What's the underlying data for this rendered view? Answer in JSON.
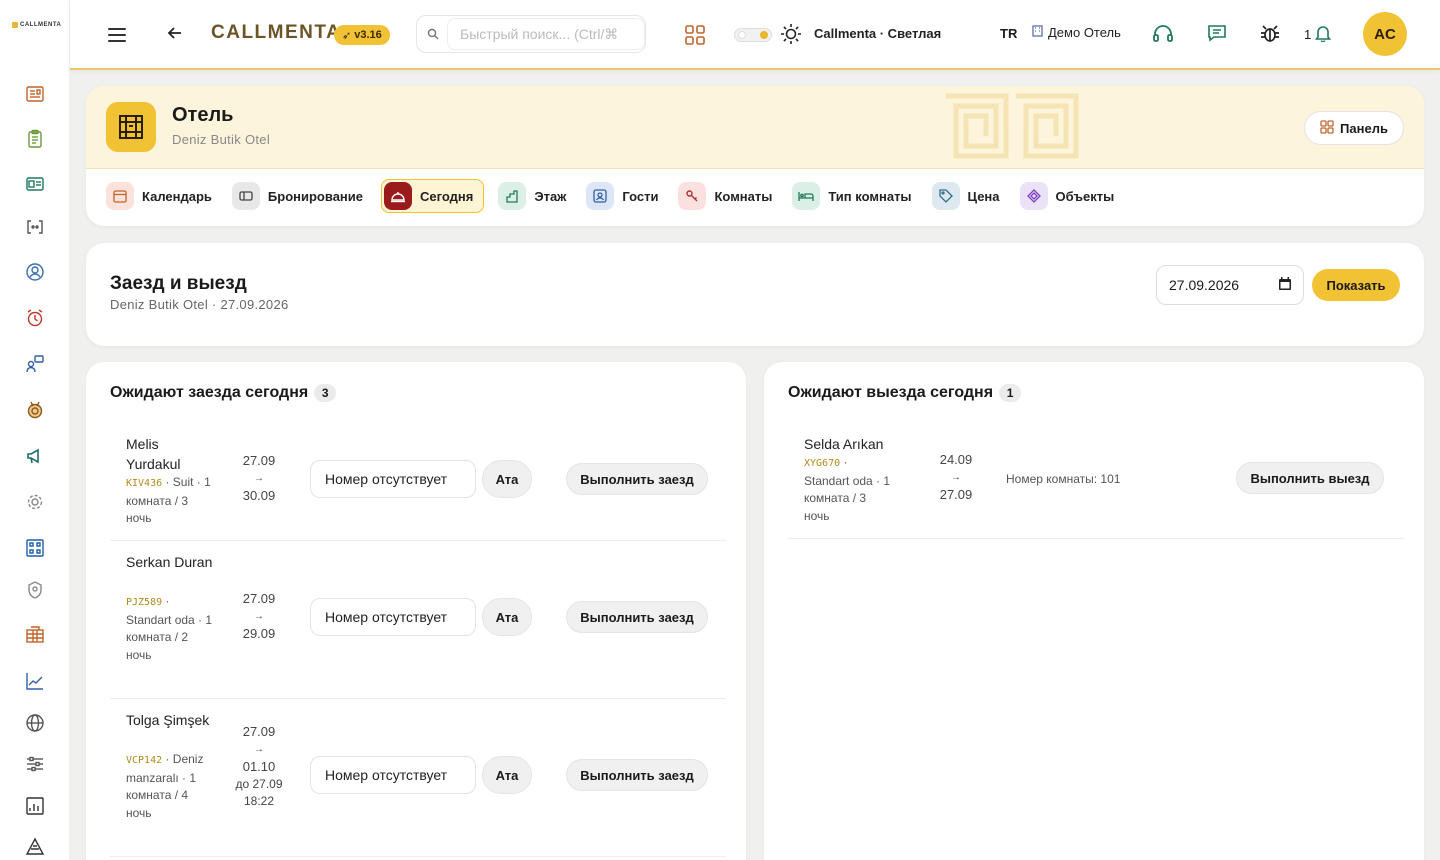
{
  "app": {
    "logo_text": "CALLMENTA",
    "brand": "CALLMENTA",
    "version": "v3.16"
  },
  "topbar": {
    "search_placeholder": "Быстрый поиск... (Ctrl/⌘",
    "theme_label": "Callmenta · Светлая",
    "language": "TR",
    "hotel_name": "Демо Отель",
    "notification_count": "1",
    "user_initials": "AC"
  },
  "sidebar": {
    "icons": [
      "dashboard-icon",
      "clipboard-icon",
      "id-card-icon",
      "code-brackets-icon",
      "user-circle-icon",
      "alarm-icon",
      "user-chat-icon",
      "medal-icon",
      "megaphone-icon",
      "gear-icon",
      "qr-grid-icon",
      "shield-icon",
      "building-icon",
      "line-chart-icon",
      "globe-icon",
      "sliders-icon",
      "bar-report-icon",
      "triangle-icon"
    ]
  },
  "hotel": {
    "title": "Отель",
    "subtitle": "Deniz Butik Otel",
    "panel_label": "Панель",
    "tabs": [
      {
        "label": "Календарь",
        "icon": "calendar-icon"
      },
      {
        "label": "Бронирование",
        "icon": "booking-icon"
      },
      {
        "label": "Сегодня",
        "icon": "service-bell-icon"
      },
      {
        "label": "Этаж",
        "icon": "floor-icon"
      },
      {
        "label": "Гости",
        "icon": "guest-icon"
      },
      {
        "label": "Комнаты",
        "icon": "key-icon"
      },
      {
        "label": "Тип комнаты",
        "icon": "bed-icon"
      },
      {
        "label": "Цена",
        "icon": "tag-icon"
      },
      {
        "label": "Объекты",
        "icon": "diamond-icon"
      }
    ],
    "active_tab": "Сегодня"
  },
  "checkio": {
    "title": "Заезд и выезд",
    "subtitle": "Deniz Butik Otel · 27.09.2026",
    "date_value": "27.09.2026",
    "show_label": "Показать"
  },
  "arrivals": {
    "title": "Ожидают заезда сегодня",
    "count": "3",
    "room_placeholder": "Номер отсутствует",
    "assign_label": "Ата",
    "action_label": "Выполнить заезд",
    "rows": [
      {
        "name": "Melis Yurdakul",
        "code": "KIV436",
        "meta": " · Suit · 1 комната / 3 ночь",
        "date_from": "27.09",
        "arrow": "→",
        "date_to": "30.09",
        "extra": ""
      },
      {
        "name": "Serkan Duran",
        "code": "PJZ589",
        "meta": " · Standart oda · 1 комната / 2 ночь",
        "date_from": "27.09",
        "arrow": "→",
        "date_to": "29.09",
        "extra": ""
      },
      {
        "name": "Tolga Şimşek",
        "code": "VCP142",
        "meta": " · Deniz manzaralı · 1 комната / 4 ночь",
        "date_from": "27.09",
        "arrow": "→",
        "date_to": "01.10",
        "extra": "до 27.09 18:22"
      }
    ]
  },
  "departures": {
    "title": "Ожидают выезда сегодня",
    "count": "1",
    "action_label": "Выполнить выезд",
    "rows": [
      {
        "name": "Selda Arıkan",
        "code": "XYG670",
        "meta": " · Standart oda · 1 комната / 3 ночь",
        "date_from": "24.09",
        "arrow": "→",
        "date_to": "27.09",
        "room": "Номер комнаты: 101"
      }
    ]
  }
}
